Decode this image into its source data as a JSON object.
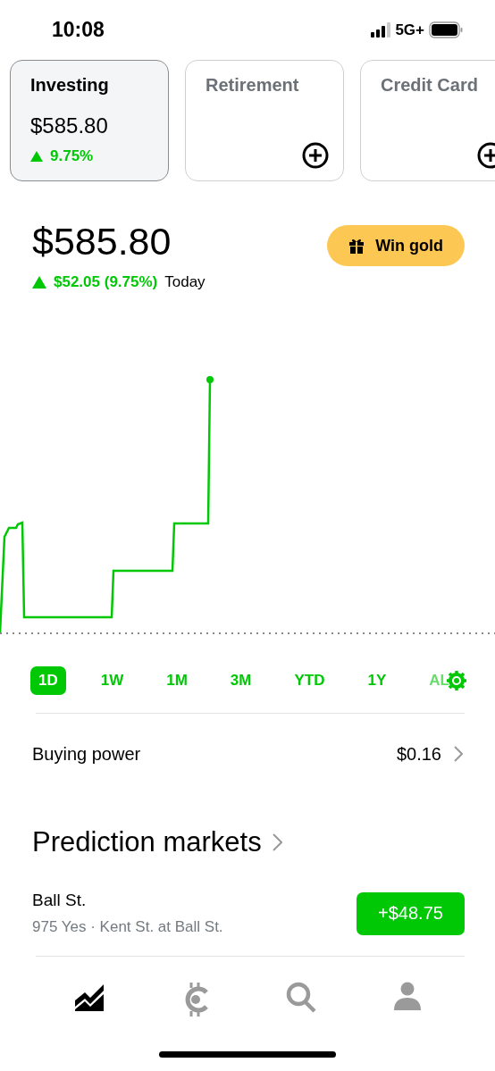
{
  "status_bar": {
    "time": "10:08",
    "network": "5G+"
  },
  "accounts": [
    {
      "kind": "balance",
      "title": "Investing",
      "selected": true,
      "value": "$585.80",
      "change": "9.75%"
    },
    {
      "kind": "add",
      "title": "Retirement",
      "selected": false
    },
    {
      "kind": "add",
      "title": "Credit Card",
      "selected": false
    }
  ],
  "portfolio": {
    "value": "$585.80",
    "change": "$52.05 (9.75%)",
    "period": "Today",
    "promo_button": "Win gold"
  },
  "ranges": [
    {
      "label": "1D",
      "selected": true
    },
    {
      "label": "1W",
      "selected": false
    },
    {
      "label": "1M",
      "selected": false
    },
    {
      "label": "3M",
      "selected": false
    },
    {
      "label": "YTD",
      "selected": false
    },
    {
      "label": "1Y",
      "selected": false
    },
    {
      "label": "AL",
      "selected": false
    }
  ],
  "buying_power": {
    "label": "Buying power",
    "value": "$0.16"
  },
  "prediction_markets": {
    "title": "Prediction markets",
    "items": [
      {
        "name": "Ball St.",
        "detail": "975 Yes · Kent St. at Ball St.",
        "amount": "+$48.75"
      }
    ]
  },
  "nav": [
    {
      "kind": "investing",
      "selected": true
    },
    {
      "kind": "crypto",
      "selected": false
    },
    {
      "kind": "search",
      "selected": false
    },
    {
      "kind": "account",
      "selected": false
    }
  ]
}
